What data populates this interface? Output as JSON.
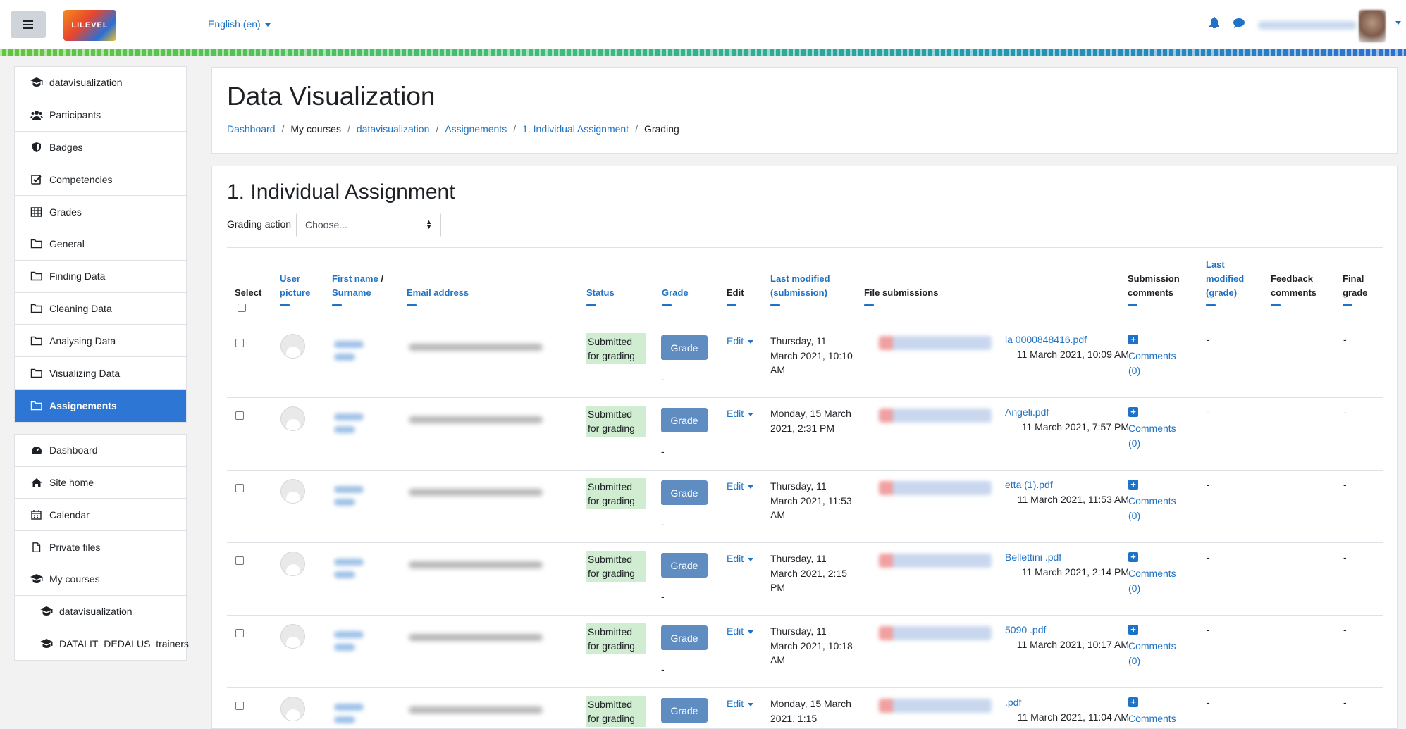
{
  "navbar": {
    "logo_text": "LILEVEL",
    "language": "English (en)"
  },
  "sidebar": {
    "course_items": [
      {
        "label": "datavisualization",
        "icon": "graduation-cap-icon"
      },
      {
        "label": "Participants",
        "icon": "users-icon"
      },
      {
        "label": "Badges",
        "icon": "shield-icon"
      },
      {
        "label": "Competencies",
        "icon": "check-square-icon"
      },
      {
        "label": "Grades",
        "icon": "table-icon"
      },
      {
        "label": "General",
        "icon": "folder-icon"
      },
      {
        "label": "Finding Data",
        "icon": "folder-icon"
      },
      {
        "label": "Cleaning Data",
        "icon": "folder-icon"
      },
      {
        "label": "Analysing Data",
        "icon": "folder-icon"
      },
      {
        "label": "Visualizing Data",
        "icon": "folder-icon"
      },
      {
        "label": "Assignements",
        "icon": "folder-icon",
        "active": true
      }
    ],
    "site_items": [
      {
        "label": "Dashboard",
        "icon": "dashboard-icon"
      },
      {
        "label": "Site home",
        "icon": "home-icon"
      },
      {
        "label": "Calendar",
        "icon": "calendar-icon"
      },
      {
        "label": "Private files",
        "icon": "file-icon"
      },
      {
        "label": "My courses",
        "icon": "graduation-cap-icon"
      },
      {
        "label": "datavisualization",
        "icon": "graduation-cap-icon"
      },
      {
        "label": "DATALIT_DEDALUS_trainers",
        "icon": "graduation-cap-icon"
      }
    ]
  },
  "header": {
    "title": "Data Visualization",
    "breadcrumb": [
      "Dashboard",
      "My courses",
      "datavisualization",
      "Assignements",
      "1. Individual Assignment",
      "Grading"
    ]
  },
  "assignment": {
    "title": "1. Individual Assignment",
    "grading_action_label": "Grading action",
    "grading_action_value": "Choose..."
  },
  "table": {
    "headers": {
      "select": "Select",
      "user_picture": "User picture",
      "first_name": "First name",
      "surname": "Surname",
      "email": "Email address",
      "status": "Status",
      "grade": "Grade",
      "edit": "Edit",
      "last_modified_submission": "Last modified (submission)",
      "file_submissions": "File submissions",
      "submission_comments": "Submission comments",
      "last_modified_grade": "Last modified (grade)",
      "feedback_comments": "Feedback comments",
      "final_grade": "Final grade"
    },
    "rows": [
      {
        "status": "Submitted for grading",
        "grade_btn": "Grade",
        "grade_val": "-",
        "edit": "Edit",
        "modified": "Thursday, 11 March 2021, 10:10 AM",
        "file": "la 0000848416.pdf",
        "file_date": "11 March 2021, 10:09 AM",
        "comments": "Comments (0)",
        "last_grade": "-",
        "final": "-"
      },
      {
        "status": "Submitted for grading",
        "grade_btn": "Grade",
        "grade_val": "-",
        "edit": "Edit",
        "modified": "Monday, 15 March 2021, 2:31 PM",
        "file": "Angeli.pdf",
        "file_date": "11 March 2021, 7:57 PM",
        "comments": "Comments (0)",
        "last_grade": "-",
        "final": "-"
      },
      {
        "status": "Submitted for grading",
        "grade_btn": "Grade",
        "grade_val": "-",
        "edit": "Edit",
        "modified": "Thursday, 11 March 2021, 11:53 AM",
        "file": "etta (1).pdf",
        "file_date": "11 March 2021, 11:53 AM",
        "comments": "Comments (0)",
        "last_grade": "-",
        "final": "-"
      },
      {
        "status": "Submitted for grading",
        "grade_btn": "Grade",
        "grade_val": "-",
        "edit": "Edit",
        "modified": "Thursday, 11 March 2021, 2:15 PM",
        "file": "Bellettini .pdf",
        "file_date": "11 March 2021, 2:14 PM",
        "comments": "Comments (0)",
        "last_grade": "-",
        "final": "-"
      },
      {
        "status": "Submitted for grading",
        "grade_btn": "Grade",
        "grade_val": "-",
        "edit": "Edit",
        "modified": "Thursday, 11 March 2021, 10:18 AM",
        "file": "5090 .pdf",
        "file_date": "11 March 2021, 10:17 AM",
        "comments": "Comments (0)",
        "last_grade": "-",
        "final": "-"
      },
      {
        "status": "Submitted for grading",
        "grade_btn": "Grade",
        "grade_val": "-",
        "edit": "Edit",
        "modified": "Monday, 15 March 2021, 1:15",
        "file": ".pdf",
        "file_date": "11 March 2021, 11:04 AM",
        "comments": "Comments",
        "last_grade": "-",
        "final": "-"
      }
    ]
  }
}
